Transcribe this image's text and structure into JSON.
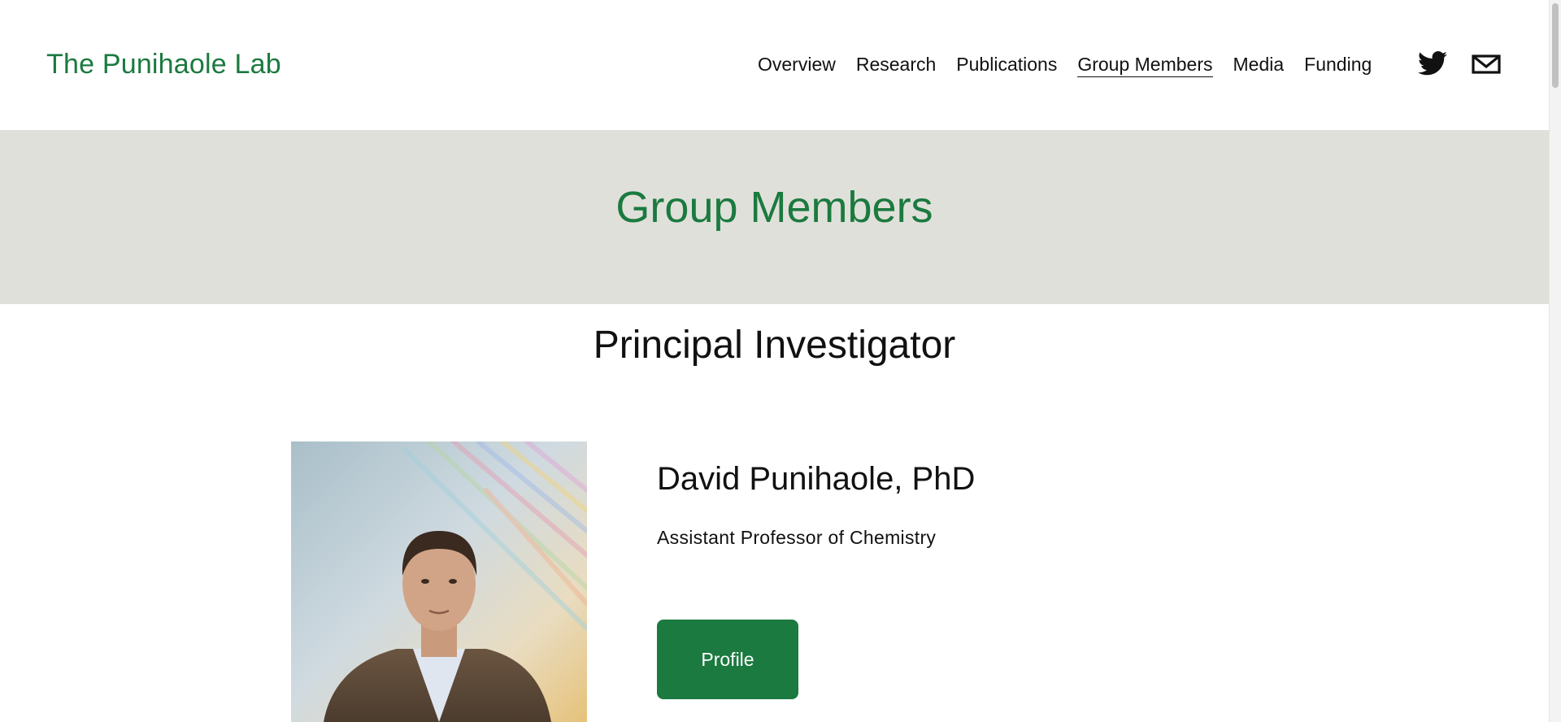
{
  "header": {
    "site_title": "The Punihaole Lab",
    "nav": [
      {
        "label": "Overview"
      },
      {
        "label": "Research"
      },
      {
        "label": "Publications"
      },
      {
        "label": "Group Members",
        "active": true
      },
      {
        "label": "Media"
      },
      {
        "label": "Funding"
      }
    ],
    "social_icons": [
      "twitter-icon",
      "email-icon"
    ]
  },
  "hero": {
    "title": "Group Members"
  },
  "section": {
    "title": "Principal Investigator"
  },
  "member": {
    "name": "David Punihaole, PhD",
    "role": "Assistant Professor of Chemistry",
    "button_label": "Profile"
  },
  "colors": {
    "brand_green": "#1b7a3f",
    "hero_bg": "#e0e0da",
    "text": "#111111"
  }
}
